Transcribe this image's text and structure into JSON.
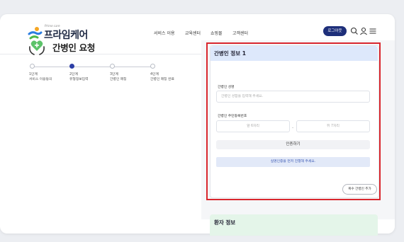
{
  "header": {
    "logo_sub": "Prime care",
    "logo_text": "프라임케어",
    "nav": [
      "서비스 이용",
      "교육센터",
      "쇼핑몰",
      "고객센터"
    ],
    "login_label": "로그아웃"
  },
  "page": {
    "title": "간병인 요청"
  },
  "steps": [
    {
      "num": "1단계",
      "label": "서비스 이용동의",
      "active": false
    },
    {
      "num": "2단계",
      "label": "유형정보입력",
      "active": true
    },
    {
      "num": "3단계",
      "label": "간병인 매칭",
      "active": false
    },
    {
      "num": "4단계",
      "label": "간병인 매칭 완료",
      "active": false
    }
  ],
  "caregiver_card": {
    "title": "간병인 정보 1",
    "name_label": "간병인 성명",
    "name_placeholder": "간병인 성함을 입력해 주세요.",
    "rrn_label": "간병인 주민등록번호",
    "rrn_front_placeholder": "앞 6자리",
    "rrn_separator": "-",
    "rrn_back_placeholder": "뒤 7자리",
    "verify_label": "인증하기",
    "notice": "실명인증을 먼저 진행해 주세요.",
    "add_label": "복수 간병인 추가"
  },
  "patient_card": {
    "title": "환자 정보"
  },
  "colors": {
    "brand_navy": "#1e2f7a",
    "active_step": "#2d3fa6",
    "highlight_red": "#d9262d",
    "card_header_blue": "#dde8fb",
    "card_header_green": "#e4f5e9"
  }
}
